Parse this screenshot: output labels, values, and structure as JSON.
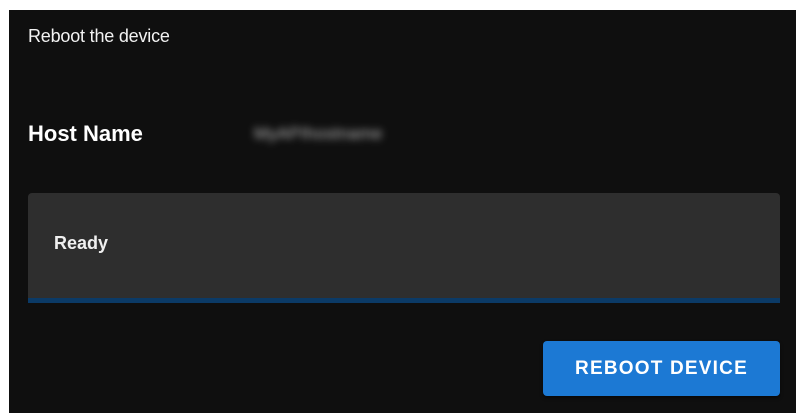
{
  "panel": {
    "title": "Reboot the device"
  },
  "host": {
    "label": "Host Name",
    "value": "MyAPIhostname"
  },
  "status": {
    "text": "Ready"
  },
  "actions": {
    "reboot_label": "REBOOT DEVICE"
  },
  "colors": {
    "background": "#0f0f0f",
    "status_box": "#2e2e2e",
    "status_underline": "#0b3a66",
    "button": "#1c79d4"
  }
}
